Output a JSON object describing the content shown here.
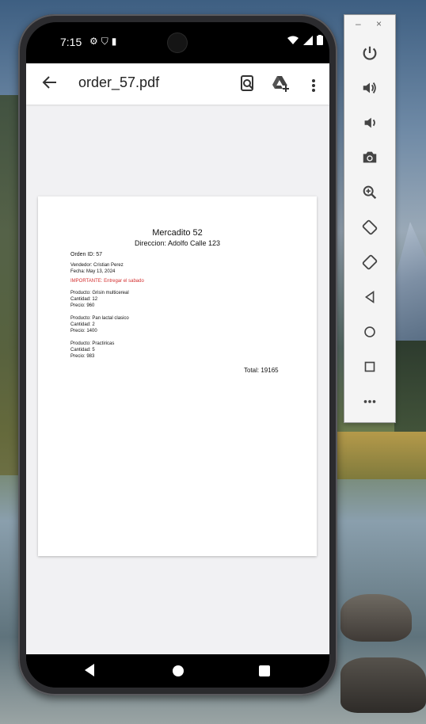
{
  "status_bar": {
    "time": "7:15",
    "left_icons": [
      "gear-icon",
      "shield-icon",
      "sd-card-icon"
    ],
    "right_icons": [
      "wifi-icon",
      "signal-icon",
      "battery-icon"
    ]
  },
  "toolbar": {
    "title": "order_57.pdf",
    "actions": [
      "search-document-icon",
      "add-to-drive-icon",
      "more-options-icon"
    ]
  },
  "document": {
    "store_name": "Mercadito 52",
    "address": "Direccion: Adolfo Calle 123",
    "order_id": "Orden ID: 57",
    "seller": "Vendedor: Cristian Perez",
    "date": "Fecha: May 13, 2024",
    "important": "IMPORTANTE: Entregar el sabado",
    "items": [
      {
        "product": "Producto: Grisin multicereal",
        "quantity": "Cantidad: 12",
        "price": "Precio: 960"
      },
      {
        "product": "Producto: Pan lactal clasico",
        "quantity": "Cantidad: 2",
        "price": "Precio: 1400"
      },
      {
        "product": "Producto: Practiricas",
        "quantity": "Cantidad: 5",
        "price": "Precio: 983"
      }
    ],
    "total": "Total: 19165"
  },
  "nav_bar": {
    "buttons": [
      "back-icon",
      "home-icon",
      "recents-icon"
    ]
  },
  "emulator_panel": {
    "minimize_label": "–",
    "close_label": "×",
    "buttons": [
      "power-icon",
      "volume-up-icon",
      "volume-down-icon",
      "camera-icon",
      "zoom-icon",
      "rotate-left-icon",
      "rotate-right-icon",
      "back-icon",
      "home-icon",
      "overview-icon",
      "more-icon"
    ]
  },
  "colors": {
    "important_text": "#d32f2f",
    "app_background": "#f1f1f3"
  }
}
